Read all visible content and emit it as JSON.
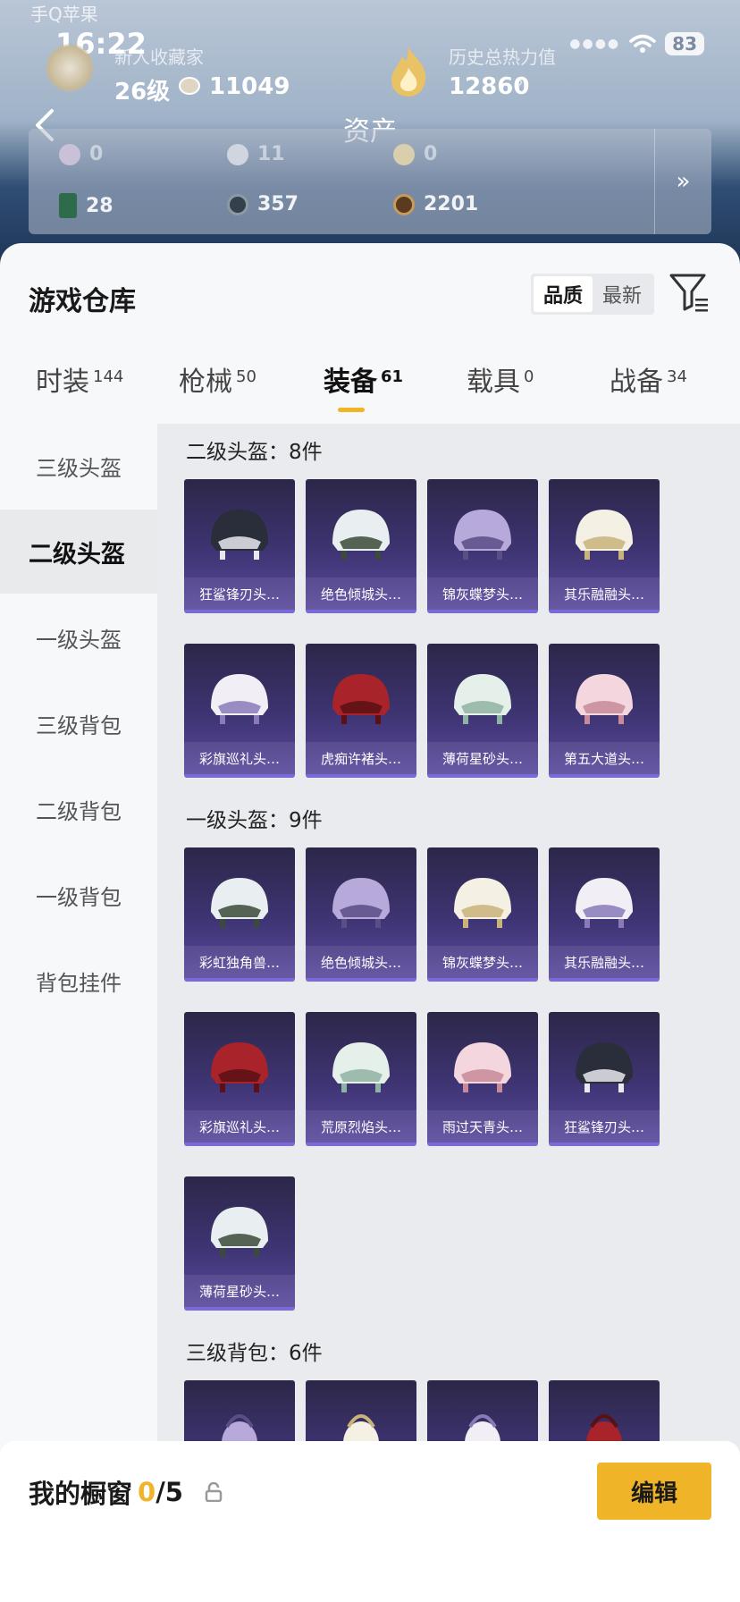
{
  "status_bar": {
    "carrier": "手Q苹果",
    "time": "16:22",
    "battery": "83"
  },
  "collector": {
    "label": "新人收藏家",
    "level": "26级",
    "coins": "11049"
  },
  "heat": {
    "label": "历史总热力值",
    "value": "12860",
    "help": "?"
  },
  "header": {
    "title": "资产"
  },
  "assets": [
    {
      "icon": "gem-icon",
      "value": "0"
    },
    {
      "icon": "silver-coin-icon",
      "value": "11"
    },
    {
      "icon": "gold-coin-icon",
      "value": "0"
    },
    {
      "icon": "card-icon",
      "value": "28"
    },
    {
      "icon": "dark-coin-icon",
      "value": "357"
    },
    {
      "icon": "bronze-coin-icon",
      "value": "2201"
    }
  ],
  "warehouse": {
    "title": "游戏仓库",
    "sort_options": [
      "品质",
      "最新"
    ],
    "sort_active": "品质"
  },
  "tabs": [
    {
      "label": "时装",
      "count": "144"
    },
    {
      "label": "枪械",
      "count": "50"
    },
    {
      "label": "装备",
      "count": "61",
      "active": true
    },
    {
      "label": "载具",
      "count": "0"
    },
    {
      "label": "战备",
      "count": "34"
    }
  ],
  "sidebar": [
    "三级头盔",
    "二级头盔",
    "一级头盔",
    "三级背包",
    "二级背包",
    "一级背包",
    "背包挂件"
  ],
  "sidebar_active": "二级头盔",
  "sections": [
    {
      "title": "二级头盔：8件",
      "items": [
        "狂鲨锋刃头…",
        "绝色倾城头…",
        "锦灰蝶梦头…",
        "其乐融融头…",
        "彩旗巡礼头…",
        "虎痴许褚头…",
        "薄荷星砂头…",
        "第五大道头…"
      ]
    },
    {
      "title": "一级头盔：9件",
      "items": [
        "彩虹独角兽…",
        "绝色倾城头…",
        "锦灰蝶梦头…",
        "其乐融融头…",
        "彩旗巡礼头…",
        "荒原烈焰头…",
        "雨过天青头…",
        "狂鲨锋刃头…",
        "薄荷星砂头…"
      ]
    },
    {
      "title": "三级背包：6件",
      "items": [
        "",
        "",
        "",
        ""
      ]
    }
  ],
  "showcase": {
    "label": "我的橱窗",
    "count": "0",
    "total": "/5"
  },
  "edit_button": "编辑",
  "colors": {
    "accent": "#f0b429",
    "card_top": "#2c2748",
    "card_bottom": "#5b4a9e"
  }
}
